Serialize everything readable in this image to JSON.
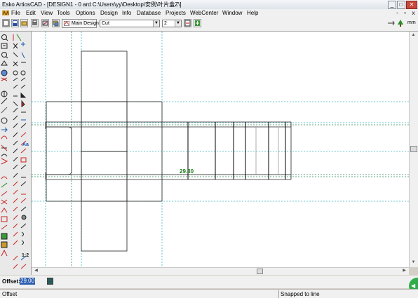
{
  "window": {
    "title": "Esko ArtiosCAD - [DESIGN1 - 0 ard C:\\Users\\yy\\Desktop\\安例\\叶片盒Z\\]",
    "minimize_label": "_",
    "maximize_label": "□",
    "close_label": "✕"
  },
  "menu": {
    "items": [
      "File",
      "Edit",
      "View",
      "Tools",
      "Options",
      "Design",
      "Info",
      "Database",
      "Projects",
      "WebCenter",
      "Window",
      "Help"
    ],
    "mdi_minimize": "-",
    "mdi_restore": "▫",
    "mdi_close": "x"
  },
  "toolbar": {
    "main_design_label": "Main Design",
    "line_type_value": "Cut",
    "pointage_value": "2",
    "right_label": "mm"
  },
  "canvas": {
    "dimension_label": "29.30"
  },
  "offset": {
    "label": "Offset:",
    "value": "29.00"
  },
  "status": {
    "left_text": "Offset",
    "snap_text": "Snapped to  line"
  },
  "colors": {
    "guide_green": "#2e8b57",
    "guide_cyan": "#40b8c0",
    "accent_green": "#2fae4b",
    "dimension_text": "#1a7a1a"
  },
  "icons": {
    "app_logo": "artioscad-logo-icon",
    "go_button": "go-icon"
  }
}
